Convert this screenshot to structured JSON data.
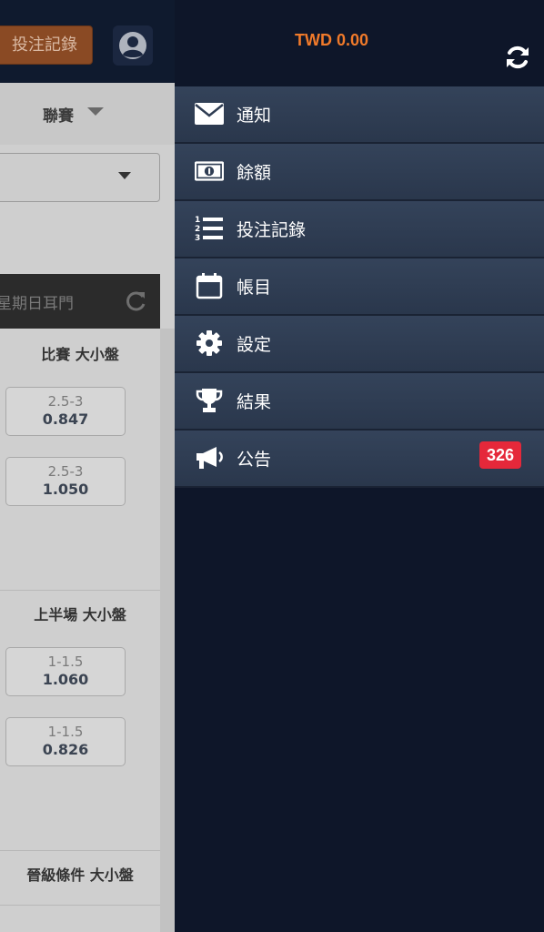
{
  "background_page": {
    "header": {
      "bet_record_label": "投注記錄"
    },
    "league_label": "聯賽",
    "dark_bar_label": "星期日耳門",
    "sections": [
      {
        "title": "比賽 大小盤",
        "odds": [
          {
            "line": "2.5-3",
            "value": "0.847"
          },
          {
            "line": "2.5-3",
            "value": "1.050"
          }
        ]
      },
      {
        "title": "上半場 大小盤",
        "odds": [
          {
            "line": "1-1.5",
            "value": "1.060"
          },
          {
            "line": "1-1.5",
            "value": "0.826"
          }
        ]
      },
      {
        "title": "晉級條件 大小盤",
        "odds": []
      }
    ]
  },
  "drawer": {
    "balance": "TWD 0.00",
    "menu": [
      {
        "label": "通知",
        "icon": "envelope-icon"
      },
      {
        "label": "餘額",
        "icon": "banknote-icon"
      },
      {
        "label": "投注記錄",
        "icon": "numbered-list-icon"
      },
      {
        "label": "帳目",
        "icon": "calendar-icon"
      },
      {
        "label": "設定",
        "icon": "gear-icon"
      },
      {
        "label": "結果",
        "icon": "trophy-icon"
      },
      {
        "label": "公告",
        "icon": "megaphone-icon",
        "badge": "326"
      }
    ]
  },
  "colors": {
    "accent_orange": "#f07a2a",
    "badge_red": "#e5283a",
    "drawer_bg": "#0e1629",
    "menu_item_bg": "#34435a"
  }
}
